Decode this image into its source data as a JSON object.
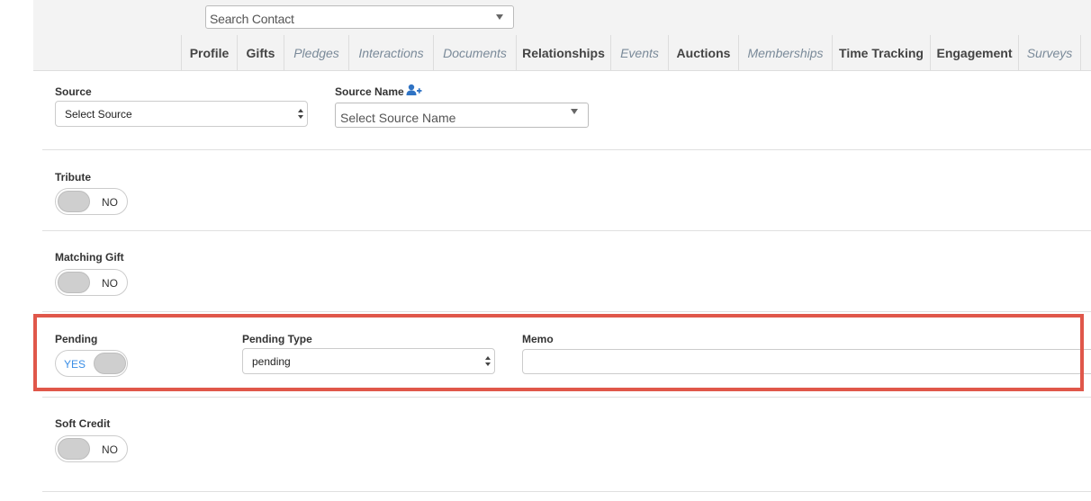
{
  "search": {
    "value": "Search Contact"
  },
  "tabs": [
    {
      "label": "Profile"
    },
    {
      "label": "Gifts"
    },
    {
      "label": "Pledges"
    },
    {
      "label": "Interactions"
    },
    {
      "label": "Documents"
    },
    {
      "label": "Relationships"
    },
    {
      "label": "Events"
    },
    {
      "label": "Auctions"
    },
    {
      "label": "Memberships"
    },
    {
      "label": "Time Tracking"
    },
    {
      "label": "Engagement"
    },
    {
      "label": "Surveys"
    }
  ],
  "form": {
    "source": {
      "label": "Source",
      "value": "Select Source"
    },
    "source_name": {
      "label": "Source Name",
      "value": "Select Source Name",
      "icon": "add-user-icon"
    },
    "tribute": {
      "label": "Tribute",
      "toggle": "NO"
    },
    "matching_gift": {
      "label": "Matching Gift",
      "toggle": "NO"
    },
    "pending": {
      "label": "Pending",
      "toggle": "YES"
    },
    "pending_type": {
      "label": "Pending Type",
      "value": "pending"
    },
    "memo": {
      "label": "Memo",
      "value": ""
    },
    "soft_credit": {
      "label": "Soft Credit",
      "toggle": "NO"
    }
  },
  "colors": {
    "highlight": "#e0574a",
    "accent": "#3a8ee6",
    "italic_tab": "#7a8a99"
  }
}
